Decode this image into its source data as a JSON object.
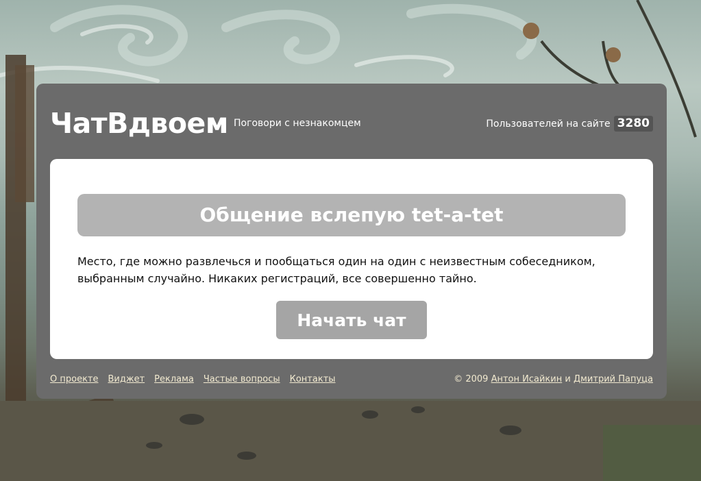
{
  "header": {
    "logo": "ЧатВдвоем",
    "tagline": "Поговори с незнакомцем",
    "online_label": "Пользователей на сайте",
    "online_count": "3280"
  },
  "main": {
    "title": "Общение вслепую tet-a-tet",
    "description": "Место, где можно развлечься и пообщаться один на один с неизвестным собеседником, выбранным случайно. Никаких регистраций, все совершенно тайно.",
    "start_button": "Начать чат"
  },
  "footer": {
    "links": [
      {
        "label": "О проекте"
      },
      {
        "label": "Виджет"
      },
      {
        "label": "Реклама"
      },
      {
        "label": "Частые вопросы"
      },
      {
        "label": "Контакты"
      }
    ],
    "copyright": "© 2009",
    "author1": "Антон Исайкин",
    "conjunction": "и",
    "author2": "Дмитрий Папуца"
  },
  "colors": {
    "panel": "#6b6b6b",
    "card": "#ffffff",
    "title_bar": "#b3b3b3",
    "button": "#a5a5a5",
    "link": "#f2ead0"
  }
}
